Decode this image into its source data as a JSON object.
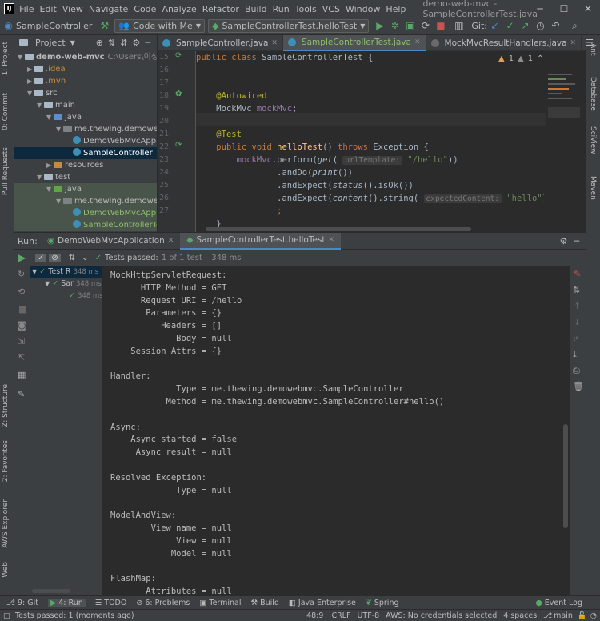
{
  "menu": {
    "items": [
      "File",
      "Edit",
      "View",
      "Navigate",
      "Code",
      "Analyze",
      "Refactor",
      "Build",
      "Run",
      "Tools",
      "VCS",
      "Window",
      "Help"
    ],
    "window_title": "demo-web-mvc - SampleControllerTest.java"
  },
  "toolbar": {
    "breadcrumb": "SampleController",
    "code_with_me": "Code with Me",
    "run_config": "SampleControllerTest.helloTest",
    "git_label": "Git:"
  },
  "side_left": [
    "1: Project",
    "0: Commit",
    "Pull Requests",
    "Z: Structure",
    "2: Favorites",
    "AWS Explorer",
    "Web"
  ],
  "side_right": [
    "Ant",
    "Database",
    "SciView",
    "Maven"
  ],
  "project": {
    "header": "Project",
    "tree": [
      {
        "label": "demo-web-mvc",
        "extra": "C:\\Users\\이성은",
        "depth": 0,
        "icon": "folder",
        "arrow": "down",
        "bold": true
      },
      {
        "label": ".idea",
        "depth": 1,
        "icon": "folder",
        "arrow": "right"
      },
      {
        "label": ".mvn",
        "depth": 1,
        "icon": "folder",
        "arrow": "right"
      },
      {
        "label": "src",
        "depth": 1,
        "icon": "folder",
        "arrow": "down"
      },
      {
        "label": "main",
        "depth": 2,
        "icon": "folder",
        "arrow": "down"
      },
      {
        "label": "java",
        "depth": 3,
        "icon": "folder blue",
        "arrow": "down"
      },
      {
        "label": "me.thewing.demowebmvc",
        "depth": 4,
        "icon": "folder gray",
        "arrow": "down"
      },
      {
        "label": "DemoWebMvcApplication",
        "depth": 5,
        "icon": "class"
      },
      {
        "label": "SampleController",
        "depth": 5,
        "icon": "class",
        "state": "selected"
      },
      {
        "label": "resources",
        "depth": 3,
        "icon": "folder orange",
        "arrow": "right"
      },
      {
        "label": "test",
        "depth": 2,
        "icon": "folder",
        "arrow": "down"
      },
      {
        "label": "java",
        "depth": 3,
        "icon": "folder green",
        "arrow": "down",
        "state": "test"
      },
      {
        "label": "me.thewing.demowebmvc",
        "depth": 4,
        "icon": "folder gray",
        "arrow": "down",
        "state": "test"
      },
      {
        "label": "DemoWebMvcApplicationTests",
        "depth": 5,
        "icon": "class",
        "state": "test"
      },
      {
        "label": "SampleControllerTest",
        "depth": 5,
        "icon": "class",
        "state": "test"
      }
    ]
  },
  "editor": {
    "tabs": [
      {
        "label": "SampleController.java",
        "active": false
      },
      {
        "label": "SampleControllerTest.java",
        "active": true
      },
      {
        "label": "MockMvcResultHandlers.java",
        "active": false
      }
    ],
    "inspections": {
      "warnings": "1",
      "weak": "1"
    },
    "line_numbers": [
      "15",
      "16",
      "17",
      "18",
      "19",
      "20",
      "21",
      "22",
      "23",
      "24",
      "25",
      "26",
      "27"
    ]
  },
  "run": {
    "label": "Run:",
    "tabs": [
      "DemoWebMvcApplication",
      "SampleControllerTest.helloTest"
    ],
    "tests_passed": "Tests passed:",
    "tests_count": "1 of 1 test – 348 ms",
    "tree": [
      {
        "label": "Test R",
        "time": "348 ms",
        "depth": 0
      },
      {
        "label": "Sar",
        "time": "348 ms",
        "depth": 1
      },
      {
        "label": "",
        "time": "348 ms",
        "depth": 2
      }
    ],
    "console": [
      "MockHttpServletRequest:",
      "      HTTP Method = GET",
      "      Request URI = /hello",
      "       Parameters = {}",
      "          Headers = []",
      "             Body = null",
      "    Session Attrs = {}",
      "",
      "Handler:",
      "             Type = me.thewing.demowebmvc.SampleController",
      "           Method = me.thewing.demowebmvc.SampleController#hello()",
      "",
      "Async:",
      "    Async started = false",
      "     Async result = null",
      "",
      "Resolved Exception:",
      "             Type = null",
      "",
      "ModelAndView:",
      "        View name = null",
      "             View = null",
      "            Model = null",
      "",
      "FlashMap:",
      "       Attributes = null"
    ]
  },
  "bottom_tabs": [
    {
      "label": "9: Git",
      "icon": "git-icon"
    },
    {
      "label": "4: Run",
      "icon": "run-icon"
    },
    {
      "label": "TODO",
      "icon": "todo-icon"
    },
    {
      "label": "6: Problems",
      "icon": "problems-icon"
    },
    {
      "label": "Terminal",
      "icon": "terminal-icon"
    },
    {
      "label": "Build",
      "icon": "build-icon"
    },
    {
      "label": "Java Enterprise",
      "icon": "enterprise-icon"
    },
    {
      "label": "Spring",
      "icon": "spring-icon"
    }
  ],
  "event_log": "Event Log",
  "status": {
    "message": "Tests passed: 1 (moments ago)",
    "position": "48:9",
    "line_sep": "CRLF",
    "encoding": "UTF-8",
    "aws": "AWS: No credentials selected",
    "indent": "4 spaces",
    "branch": "main"
  },
  "colors": {
    "accent": "#4a88c7",
    "pass": "#59a869",
    "bg": "#2b2b2b",
    "panel": "#3c3f41"
  }
}
